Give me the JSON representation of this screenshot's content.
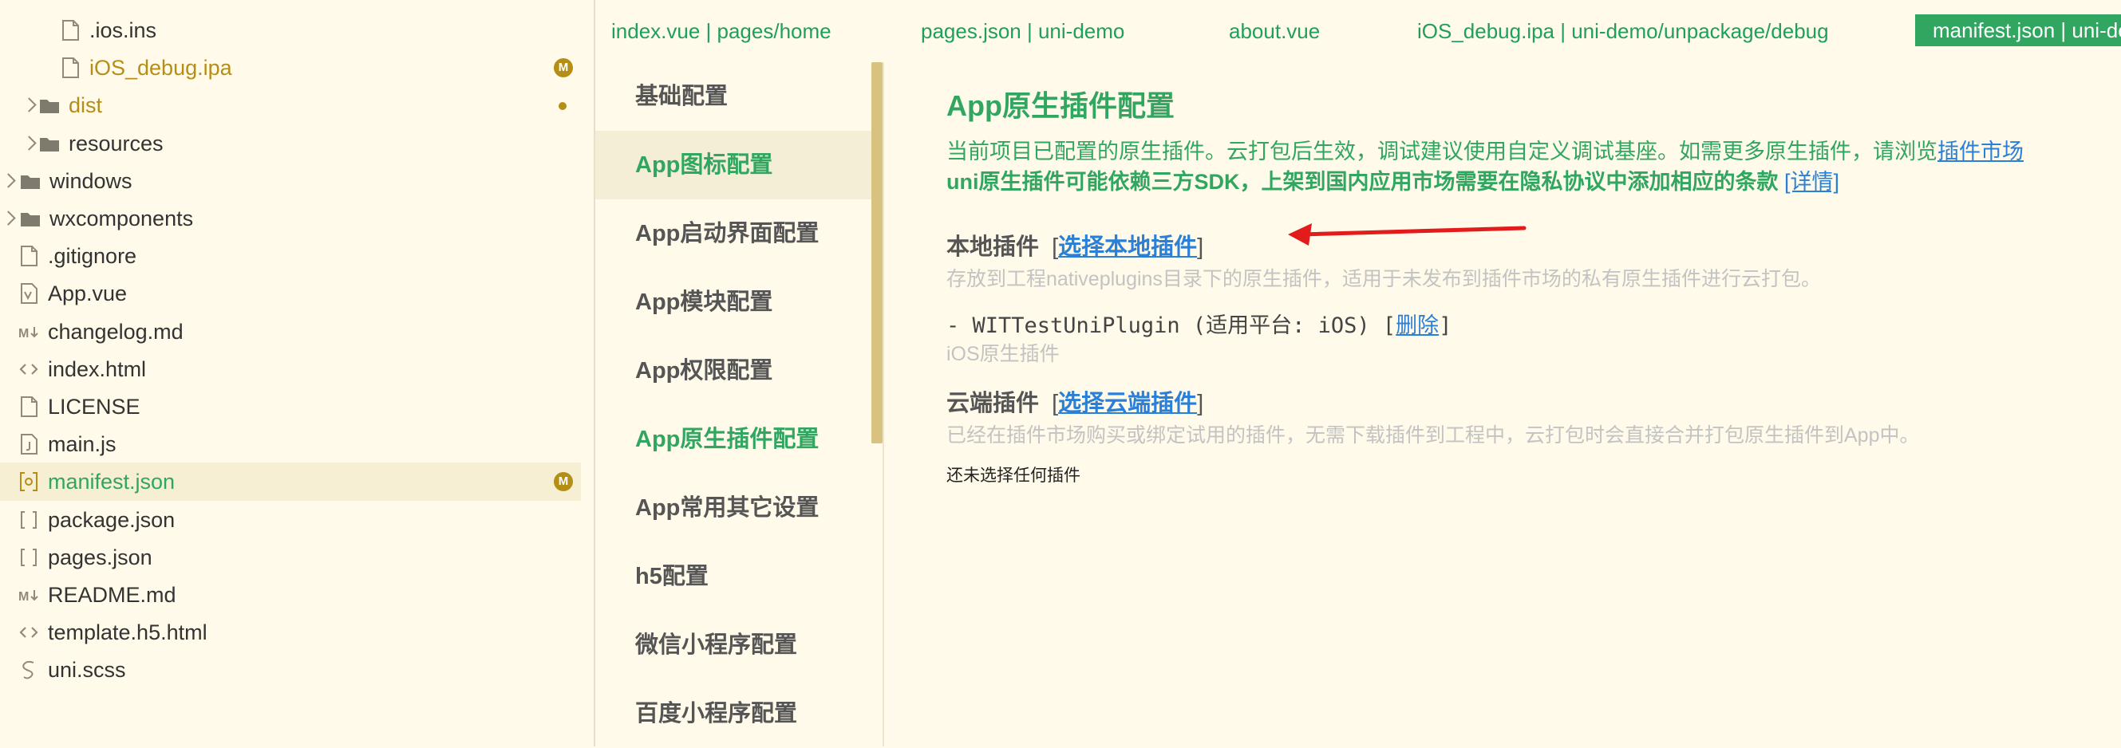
{
  "file_tree": {
    "items": [
      {
        "label": ".ios.ins",
        "icon": "file-icon",
        "chevron": false,
        "badge": "",
        "dot": false,
        "selected": false,
        "color": "#333333",
        "depth": 2
      },
      {
        "label": "iOS_debug.ipa",
        "icon": "file-icon",
        "chevron": false,
        "badge": "M",
        "dot": false,
        "selected": false,
        "color": "#b58e16",
        "depth": 2
      },
      {
        "label": "dist",
        "icon": "folder-icon",
        "chevron": true,
        "badge": "",
        "dot": true,
        "selected": false,
        "color": "#b58e16",
        "depth": 1
      },
      {
        "label": "resources",
        "icon": "folder-icon",
        "chevron": true,
        "badge": "",
        "dot": false,
        "selected": false,
        "color": "#333333",
        "depth": 1
      },
      {
        "label": "windows",
        "icon": "folder-icon",
        "chevron": true,
        "badge": "",
        "dot": false,
        "selected": false,
        "color": "#333333",
        "depth": 0
      },
      {
        "label": "wxcomponents",
        "icon": "folder-icon",
        "chevron": true,
        "badge": "",
        "dot": false,
        "selected": false,
        "color": "#333333",
        "depth": 0
      },
      {
        "label": ".gitignore",
        "icon": "file-icon",
        "chevron": false,
        "badge": "",
        "dot": false,
        "selected": false,
        "color": "#333333",
        "depth": 0
      },
      {
        "label": "App.vue",
        "icon": "vue-file-icon",
        "chevron": false,
        "badge": "",
        "dot": false,
        "selected": false,
        "color": "#333333",
        "depth": 0
      },
      {
        "label": "changelog.md",
        "icon": "markdown-icon",
        "chevron": false,
        "badge": "",
        "dot": false,
        "selected": false,
        "color": "#333333",
        "depth": 0
      },
      {
        "label": "index.html",
        "icon": "html-icon",
        "chevron": false,
        "badge": "",
        "dot": false,
        "selected": false,
        "color": "#333333",
        "depth": 0
      },
      {
        "label": "LICENSE",
        "icon": "file-icon",
        "chevron": false,
        "badge": "",
        "dot": false,
        "selected": false,
        "color": "#333333",
        "depth": 0
      },
      {
        "label": "main.js",
        "icon": "js-file-icon",
        "chevron": false,
        "badge": "",
        "dot": false,
        "selected": false,
        "color": "#333333",
        "depth": 0
      },
      {
        "label": "manifest.json",
        "icon": "manifest-icon",
        "chevron": false,
        "badge": "M",
        "dot": false,
        "selected": true,
        "color": "#30a660",
        "depth": 0
      },
      {
        "label": "package.json",
        "icon": "json-icon",
        "chevron": false,
        "badge": "",
        "dot": false,
        "selected": false,
        "color": "#333333",
        "depth": 0
      },
      {
        "label": "pages.json",
        "icon": "json-icon",
        "chevron": false,
        "badge": "",
        "dot": false,
        "selected": false,
        "color": "#333333",
        "depth": 0
      },
      {
        "label": "README.md",
        "icon": "markdown-icon",
        "chevron": false,
        "badge": "",
        "dot": false,
        "selected": false,
        "color": "#333333",
        "depth": 0
      },
      {
        "label": "template.h5.html",
        "icon": "html-icon",
        "chevron": false,
        "badge": "",
        "dot": false,
        "selected": false,
        "color": "#333333",
        "depth": 0
      },
      {
        "label": "uni.scss",
        "icon": "scss-icon",
        "chevron": false,
        "badge": "",
        "dot": false,
        "selected": false,
        "color": "#333333",
        "depth": 0
      }
    ]
  },
  "tabs": [
    {
      "label": "index.vue | pages/home",
      "active": false
    },
    {
      "label": "pages.json | uni-demo",
      "active": false
    },
    {
      "label": "about.vue",
      "active": false
    },
    {
      "label": "iOS_debug.ipa | uni-demo/unpackage/debug",
      "active": false
    },
    {
      "label": "manifest.json | uni-demo",
      "active": true
    }
  ],
  "nav": {
    "items": [
      {
        "label": "基础配置",
        "active": false,
        "green": false
      },
      {
        "label": "App图标配置",
        "active": true,
        "green": true
      },
      {
        "label": "App启动界面配置",
        "active": false,
        "green": false
      },
      {
        "label": "App模块配置",
        "active": false,
        "green": false
      },
      {
        "label": "App权限配置",
        "active": false,
        "green": false
      },
      {
        "label": "App原生插件配置",
        "active": false,
        "green": true
      },
      {
        "label": "App常用其它设置",
        "active": false,
        "green": false
      },
      {
        "label": "h5配置",
        "active": false,
        "green": false
      },
      {
        "label": "微信小程序配置",
        "active": false,
        "green": false
      },
      {
        "label": "百度小程序配置",
        "active": false,
        "green": false
      }
    ]
  },
  "content": {
    "title": "App原生插件配置",
    "intro": "当前项目已配置的原生插件。云打包后生效，调试建议使用自定义调试基座。如需更多原生插件，请浏览",
    "intro_link": "插件市场",
    "notice": "uni原生插件可能依赖三方SDK，上架到国内应用市场需要在隐私协议中添加相应的条款",
    "notice_link": "[详情]",
    "local": {
      "heading": "本地插件",
      "bracket_open": "[",
      "link": "选择本地插件",
      "bracket_close": "]",
      "description": "存放到工程nativeplugins目录下的原生插件，适用于未发布到插件市场的私有原生插件进行云打包。",
      "plugin_prefix": "- WITTestUniPlugin (适用平台: iOS) [",
      "plugin_delete": "删除",
      "plugin_suffix": "]",
      "plugin_desc": "iOS原生插件"
    },
    "cloud": {
      "heading": "云端插件",
      "bracket_open": "[",
      "link": "选择云端插件",
      "bracket_close": "]",
      "description": "已经在插件市场购买或绑定试用的插件，无需下载插件到工程中，云打包时会直接合并打包原生插件到App中。",
      "empty": "还未选择任何插件"
    }
  },
  "colors": {
    "background": "#fffae9",
    "accent_green": "#30a660",
    "link_blue": "#2a7fd6",
    "modified_gold": "#b58e16",
    "annotation_red": "#e21b1b"
  }
}
